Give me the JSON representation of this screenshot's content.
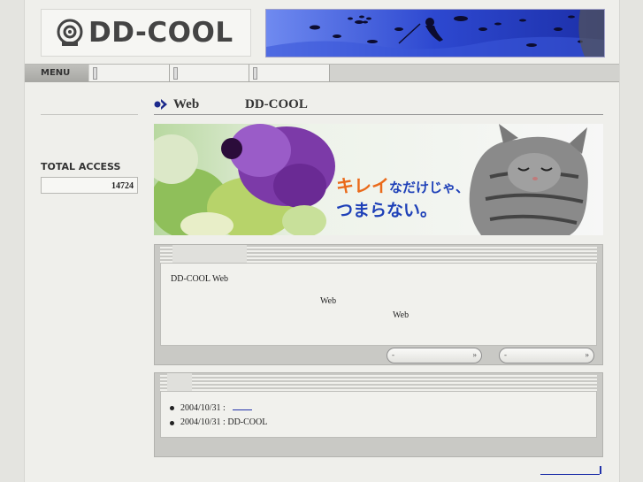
{
  "header": {
    "logo_text": "DD-COOL"
  },
  "menu": {
    "label": "MENU",
    "slots": [
      "",
      "",
      ""
    ]
  },
  "sidebar": {
    "total_access_label": "TOTAL ACCESS",
    "total_access_count": "14724"
  },
  "main": {
    "heading_web": "Web",
    "heading_site": "DD-COOL",
    "hero": {
      "line1_highlight": "キレイ",
      "line1_rest": "なだけじゃ、",
      "line2": "つまらない。"
    },
    "intro": {
      "line1": "DD-COOL  Web",
      "line2": "Web",
      "line3": "Web"
    },
    "news": [
      {
        "date": "2004/10/31 :",
        "text": ""
      },
      {
        "date": "2004/10/31 :",
        "text": "DD-COOL"
      }
    ]
  },
  "colors": {
    "accent_blue": "#1c2a8c",
    "hero_orange": "#ea6a1a",
    "hero_blue": "#1e40b8",
    "ocean": "#2f4fd0"
  }
}
